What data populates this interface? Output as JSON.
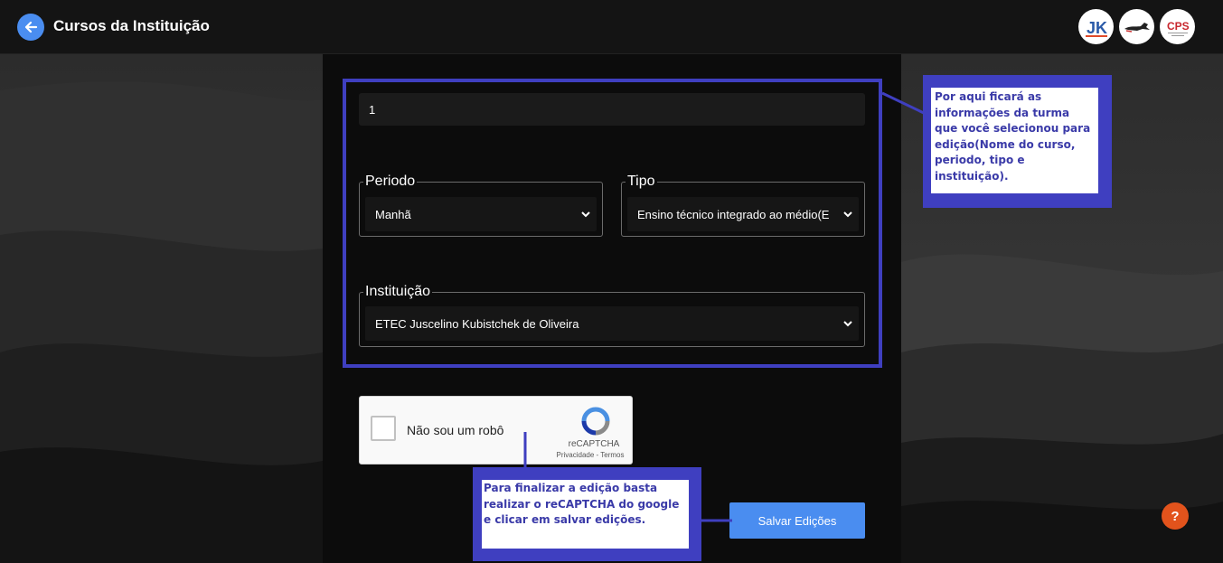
{
  "header": {
    "title": "Cursos da Instituição",
    "back_icon": "arrow-left-icon",
    "logos": [
      "jk-logo",
      "horse-logo",
      "cps-logo"
    ],
    "logo_texts": [
      "JK",
      "CPS"
    ]
  },
  "form": {
    "course_name_value": "1",
    "periodo": {
      "label": "Periodo",
      "value": "Manhã"
    },
    "tipo": {
      "label": "Tipo",
      "value": "Ensino técnico integrado ao médio(E"
    },
    "instituicao": {
      "label": "Instituição",
      "value": "ETEC Juscelino Kubistchek de Oliveira"
    }
  },
  "annotations": {
    "note_fields": "Por aqui ficará as informações da turma que você selecionou para edição(Nome do curso, periodo, tipo e instituição).",
    "note_submit": "Para finalizar a edição basta realizar o reCAPTCHA do google e clicar em salvar edições."
  },
  "captcha": {
    "label": "Não sou um robô",
    "brand": "reCAPTCHA",
    "privacy": "Privacidade",
    "separator": " - ",
    "terms": "Termos"
  },
  "actions": {
    "save_label": "Salvar Edições",
    "help_label": "?"
  },
  "colors": {
    "accent": "#4a8df0",
    "annotation": "#3f3fc0",
    "help": "#e2531c"
  }
}
